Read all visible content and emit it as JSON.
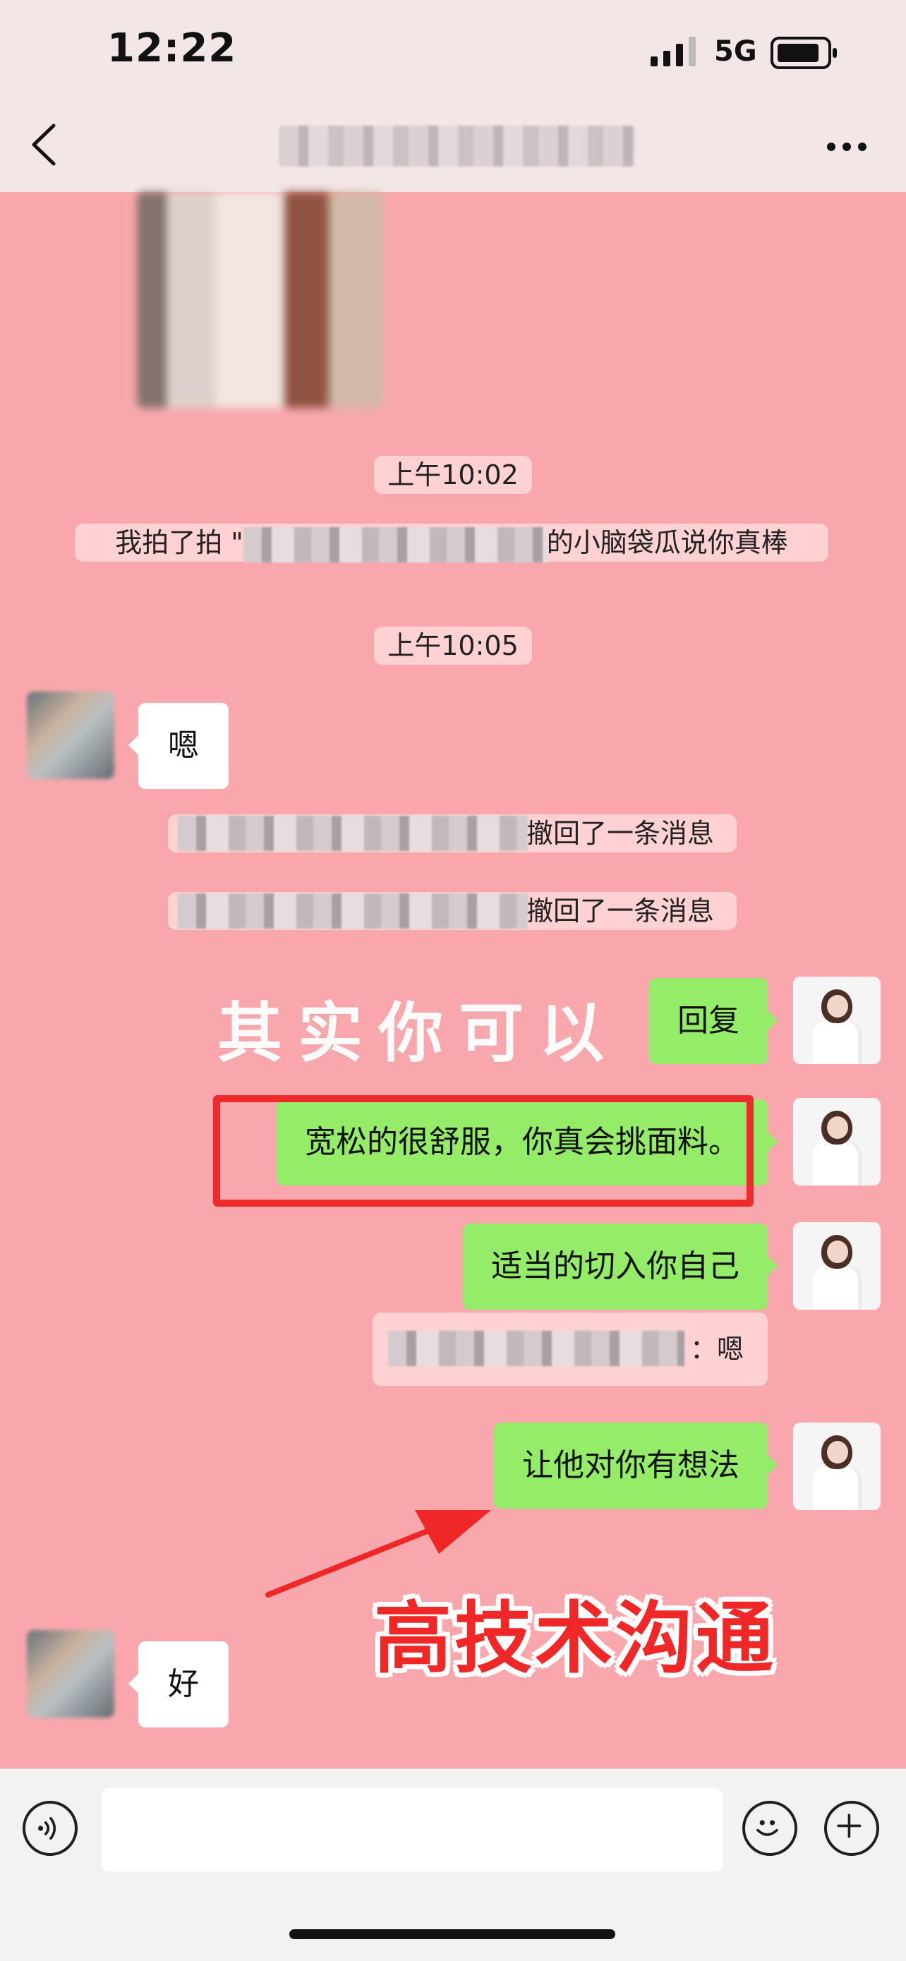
{
  "status_bar": {
    "time": "12:22",
    "network": "5G"
  },
  "header": {
    "title": "",
    "back_icon": "chevron-left-icon",
    "more_icon": "more-dots-icon"
  },
  "messages": {
    "timestamp_1": "上午10:02",
    "pat_prefix": "我拍了拍 \"",
    "pat_suffix": "的小脑袋瓜说你真棒",
    "timestamp_2": "上午10:05",
    "left_1": "嗯",
    "recall_1": "撤回了一条消息",
    "recall_2": "撤回了一条消息",
    "right_1": "回复",
    "right_2": "宽松的很舒服，你真会挑面料。",
    "right_3": "适当的切入你自己",
    "quote_suffix": "：嗯",
    "right_4": "让他对你有想法",
    "left_2": "好"
  },
  "overlays": {
    "headline": "其实你可以",
    "callout": "高技术沟通",
    "highlight_color": "#ee2a2a"
  },
  "input_bar": {
    "voice_icon": "voice-icon",
    "emoji_icon": "emoji-icon",
    "plus_icon": "plus-icon"
  },
  "colors": {
    "chat_bg": "#f8a8ac",
    "sent_bubble": "#95ec69",
    "received_bubble": "#ffffff"
  }
}
